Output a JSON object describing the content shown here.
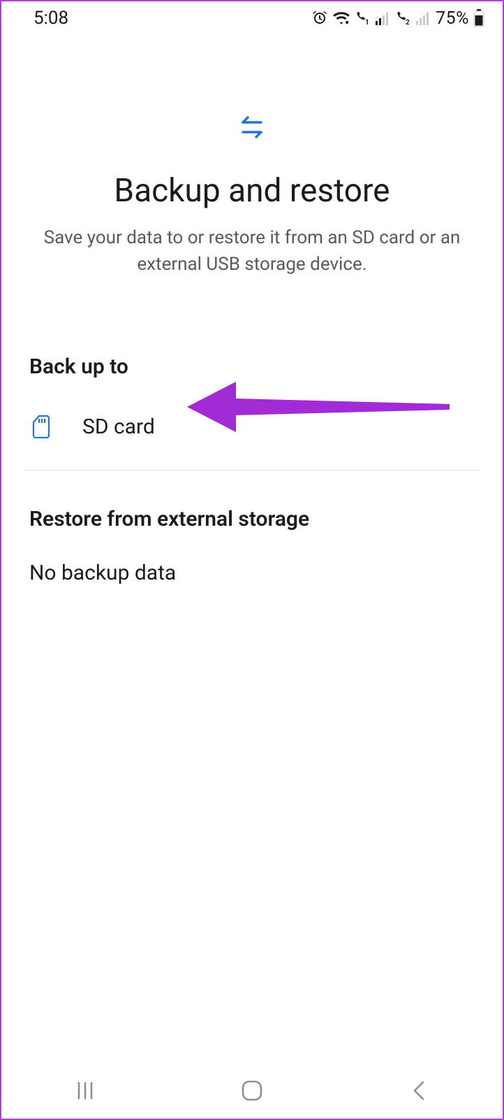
{
  "status": {
    "time": "5:08",
    "battery_text": "75%"
  },
  "header": {
    "title": "Backup and restore",
    "subtitle": "Save your data to or restore it from an SD card or an external USB storage device."
  },
  "backup": {
    "section_title": "Back up to",
    "item_label": "SD card"
  },
  "restore": {
    "section_title": "Restore from external storage",
    "empty_text": "No backup data"
  },
  "colors": {
    "accent_blue": "#1f74e0",
    "arrow_purple": "#a22bd6"
  }
}
